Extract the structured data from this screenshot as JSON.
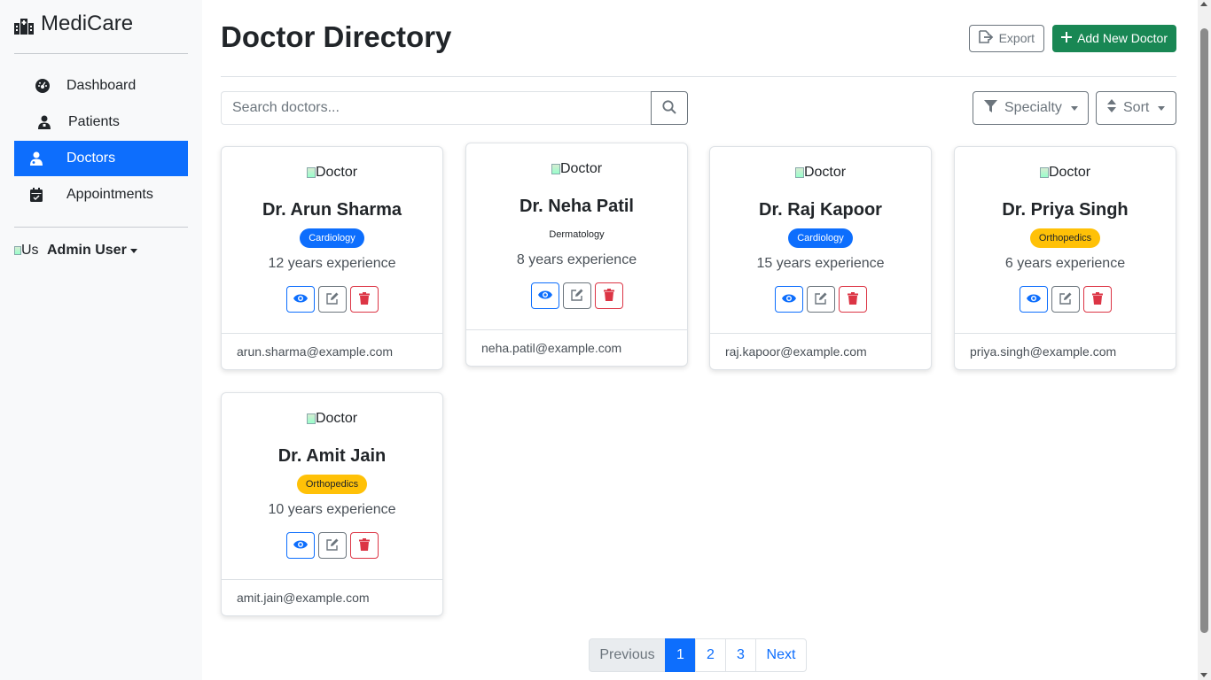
{
  "app": {
    "brand": "MediCare"
  },
  "sidebar": {
    "items": [
      {
        "label": "Dashboard",
        "icon": "dashboard-icon",
        "active": false
      },
      {
        "label": "Patients",
        "icon": "patient-icon",
        "active": false
      },
      {
        "label": "Doctors",
        "icon": "doctor-icon",
        "active": true
      },
      {
        "label": "Appointments",
        "icon": "calendar-icon",
        "active": false
      }
    ],
    "user": {
      "avatar_alt": "Us",
      "name": "Admin User"
    }
  },
  "header": {
    "title": "Doctor Directory",
    "export_label": "Export",
    "add_label": "Add New Doctor"
  },
  "toolbar": {
    "search_placeholder": "Search doctors...",
    "specialty_label": "Specialty",
    "sort_label": "Sort"
  },
  "doctors": [
    {
      "img_alt": "Doctor",
      "name": "Dr. Arun Sharma",
      "specialty": "Cardiology",
      "badge_color": "#0d6efd",
      "experience": "12 years experience",
      "email": "arun.sharma@example.com"
    },
    {
      "img_alt": "Doctor",
      "name": "Dr. Neha Patil",
      "specialty": "Dermatology",
      "badge_color": "none",
      "experience": "8 years experience",
      "email": "neha.patil@example.com"
    },
    {
      "img_alt": "Doctor",
      "name": "Dr. Raj Kapoor",
      "specialty": "Cardiology",
      "badge_color": "#0d6efd",
      "experience": "15 years experience",
      "email": "raj.kapoor@example.com"
    },
    {
      "img_alt": "Doctor",
      "name": "Dr. Priya Singh",
      "specialty": "Orthopedics",
      "badge_color": "#ffc107",
      "experience": "6 years experience",
      "email": "priya.singh@example.com"
    },
    {
      "img_alt": "Doctor",
      "name": "Dr. Amit Jain",
      "specialty": "Orthopedics",
      "badge_color": "#ffc107",
      "experience": "10 years experience",
      "email": "amit.jain@example.com"
    }
  ],
  "pagination": {
    "previous": "Previous",
    "pages": [
      "1",
      "2",
      "3"
    ],
    "current": "1",
    "next": "Next"
  },
  "colors": {
    "primary": "#0d6efd",
    "success": "#198754",
    "danger": "#dc3545",
    "warning": "#ffc107",
    "secondary": "#6c757d"
  }
}
